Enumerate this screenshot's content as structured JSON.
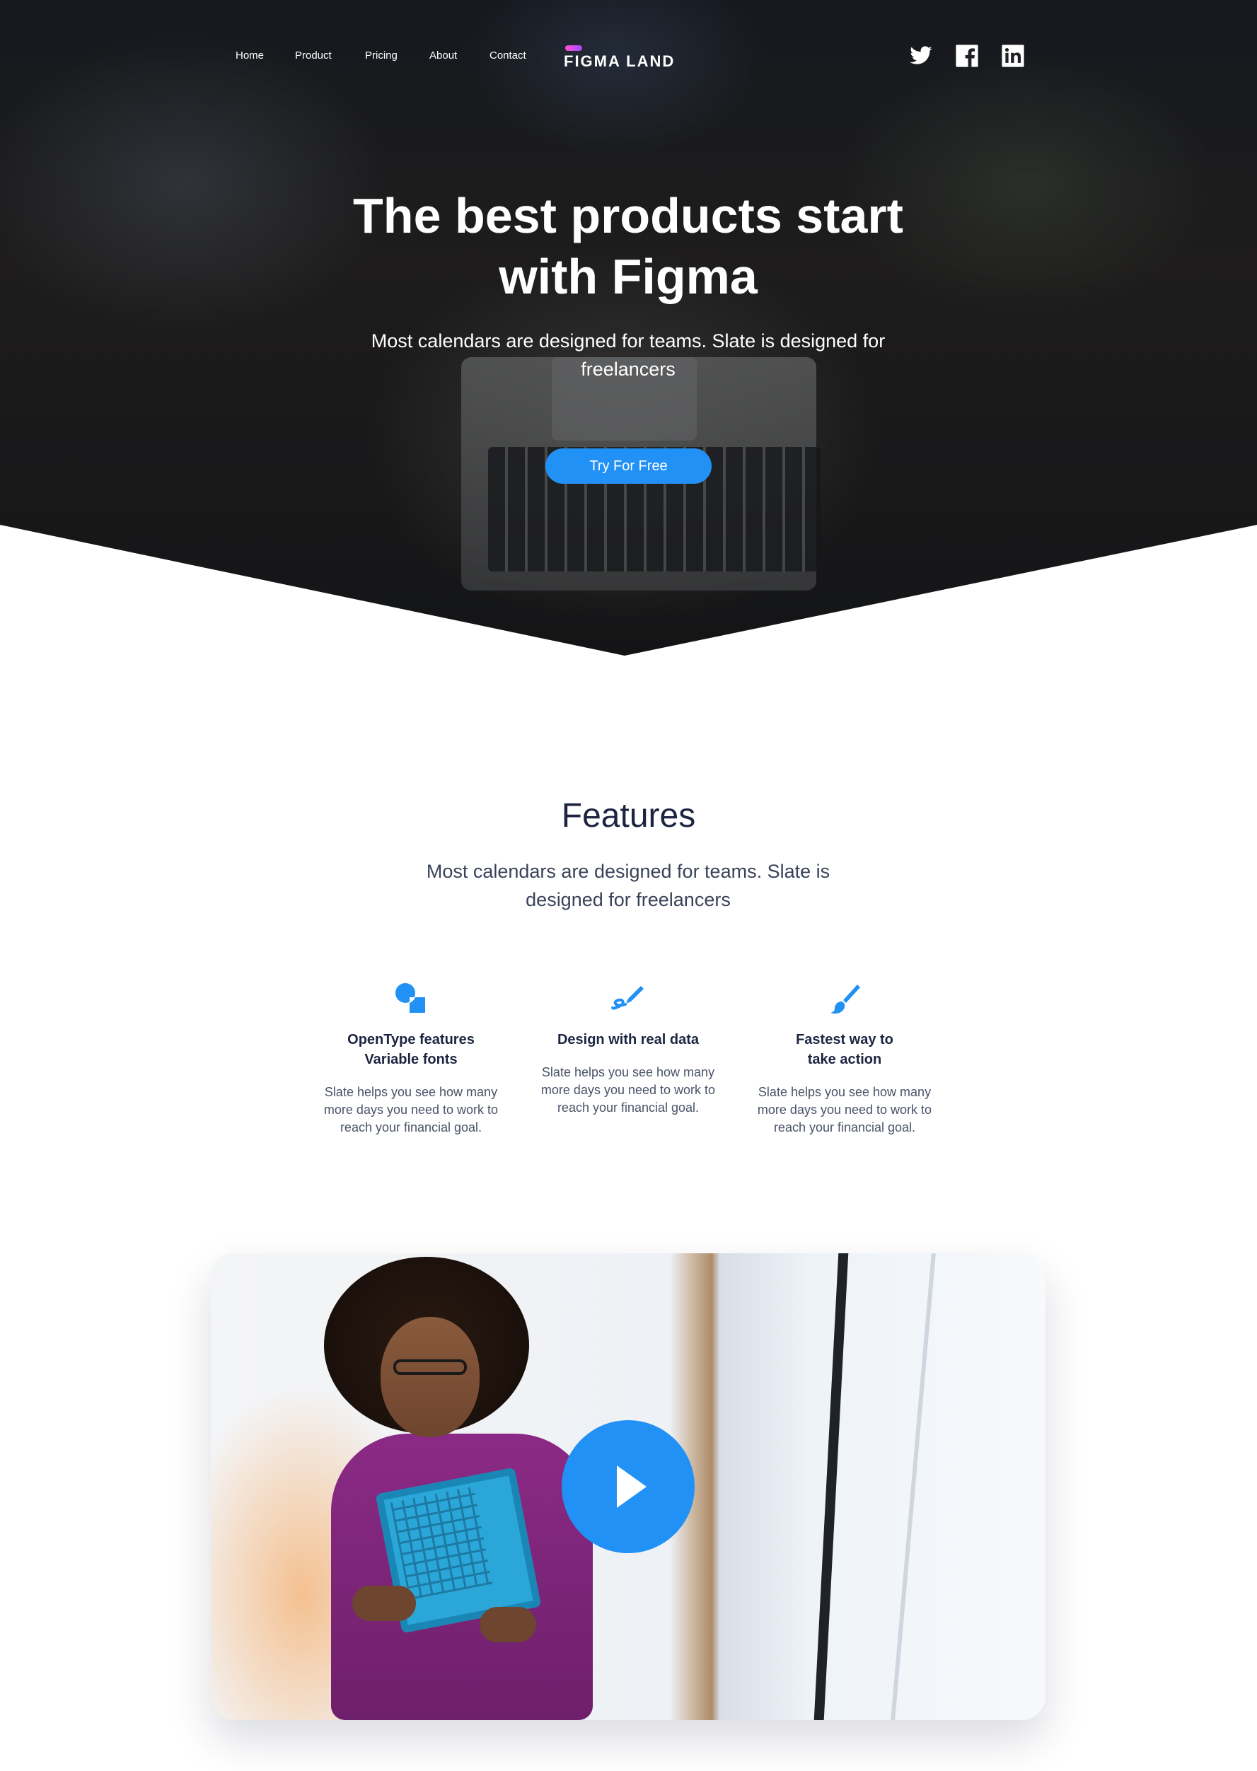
{
  "nav": {
    "links": [
      "Home",
      "Product",
      "Pricing",
      "About",
      "Contact"
    ],
    "logo_text": "FIGMA LAND",
    "social_icons": [
      "twitter-icon",
      "facebook-icon",
      "linkedin-icon"
    ]
  },
  "hero": {
    "title": "The best products start with Figma",
    "subtitle": "Most calendars are designed for teams. Slate is designed for freelancers",
    "cta_label": "Try For Free"
  },
  "features": {
    "title": "Features",
    "subtitle": "Most calendars are designed for teams. Slate is designed for freelancers",
    "items": [
      {
        "icon": "shapes-icon",
        "title": "OpenType features\nVariable fonts",
        "text": "Slate helps you see how many more days you need to work to reach your financial goal."
      },
      {
        "icon": "pen-icon",
        "title": "Design with real data",
        "text": "Slate helps you see how many more days you need to work to reach your financial goal."
      },
      {
        "icon": "brush-icon",
        "title": "Fastest way to\ntake action",
        "text": "Slate helps you see how many more days you need to work to reach your financial goal."
      }
    ]
  },
  "video": {
    "play_icon": "play-icon"
  },
  "colors": {
    "accent": "#2291f5",
    "heading": "#1c2440",
    "body_text": "#4a5268",
    "logo_accent": "#ff4fd1"
  }
}
